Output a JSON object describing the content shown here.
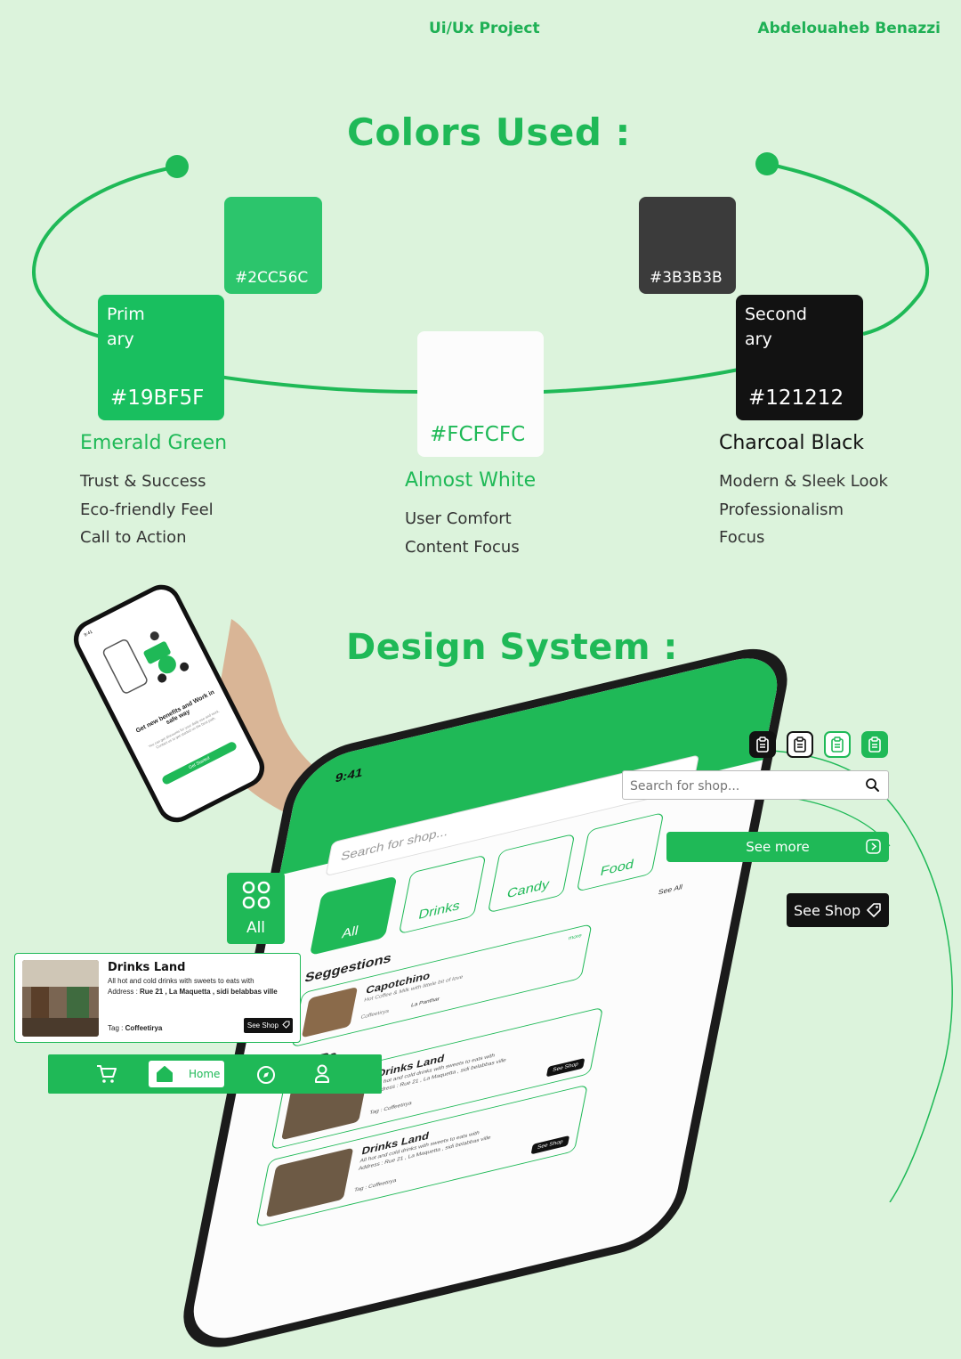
{
  "header": {
    "project": "Ui/Ux Project",
    "author": "Abdelouaheb Benazzi"
  },
  "colors_section": {
    "title": "Colors Used :",
    "swatches": [
      {
        "hex_label": "#2CC56C",
        "color": "#2CC56C"
      },
      {
        "role": "Primary",
        "role_line1": "Prim",
        "role_line2": "ary",
        "hex_label": "#19BF5F",
        "color": "#19BF5F"
      },
      {
        "hex_label": "#FCFCFC",
        "color": "#FCFCFC"
      },
      {
        "hex_label": "#3B3B3B",
        "color": "#3B3B3B"
      },
      {
        "role": "Secondary",
        "role_line1": "Second",
        "role_line2": "ary",
        "hex_label": "#121212",
        "color": "#121212"
      }
    ],
    "emerald": {
      "name": "Emerald Green",
      "features": [
        "Trust & Success",
        "Eco-friendly Feel",
        "Call to Action"
      ]
    },
    "white": {
      "name": "Almost White",
      "features": [
        "User Comfort",
        "Content Focus"
      ]
    },
    "charcoal": {
      "name": "Charcoal Black",
      "features": [
        "Modern & Sleek Look",
        "Professionalism",
        "Focus"
      ]
    }
  },
  "design_system": {
    "title": "Design System :",
    "icons": [
      "clipboard-icon-dark",
      "clipboard-icon-outline",
      "clipboard-icon-light",
      "clipboard-icon-green"
    ],
    "search": {
      "placeholder": "Search for shop..."
    },
    "see_more": "See more",
    "see_shop": "See Shop",
    "category_all": "All",
    "card": {
      "title": "Drinks Land",
      "desc": "All hot and cold drinks with sweets to eats with",
      "address_label": "Address : ",
      "address": "Rue 21 , La Maquetta , sidi belabbas ville",
      "tag_label": "Tag : ",
      "tag": "Coffeetirya",
      "button": "See Shop"
    },
    "navbar": {
      "home": "Home"
    }
  },
  "hand_phone": {
    "time": "9:41",
    "heading": "Get new benefits and Work in safe way",
    "body": "You can get discounts for your daily use and work. Contact us to get started on the best path.",
    "button": "Get Started"
  },
  "big_phone": {
    "time": "9:41",
    "search_placeholder": "Search for shop...",
    "categories": [
      "All",
      "Drinks",
      "Candy",
      "Food"
    ],
    "see_all": "See All",
    "suggestions_title": "Seggestions",
    "suggestion": {
      "title": "Capotchino",
      "desc": "Hot Coffee & Milk with littele bit of love",
      "shop": "Coffeetirya",
      "tag": "La Panthar",
      "more": "more"
    },
    "shops_title": "SHOPs",
    "shop_title": "Drinks Land",
    "shop_desc": "All hot and cold drinks with sweets to eats with",
    "shop_address": "Address : Rue 21 , La Maquetta , sidi belabbas ville",
    "shop_tag": "Tag : Coffeetirya",
    "shop_button": "See Shop"
  },
  "palette": {
    "accent": "#1fb957",
    "dark": "#121212",
    "bg": "#dcf3dc"
  }
}
